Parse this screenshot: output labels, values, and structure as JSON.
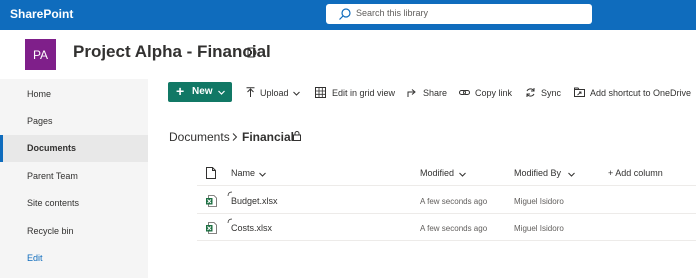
{
  "topbar": {
    "app_name": "SharePoint",
    "search_placeholder": "Search this library"
  },
  "site": {
    "logo_initials": "PA",
    "title": "Project Alpha - Financial"
  },
  "leftnav": {
    "items": [
      {
        "label": "Home"
      },
      {
        "label": "Pages"
      },
      {
        "label": "Documents",
        "active": true
      },
      {
        "label": "Parent Team"
      },
      {
        "label": "Site contents"
      },
      {
        "label": "Recycle bin"
      },
      {
        "label": "Edit"
      }
    ]
  },
  "commandbar": {
    "new_label": "New",
    "upload_label": "Upload",
    "grid_label": "Edit in grid view",
    "share_label": "Share",
    "copy_link_label": "Copy link",
    "sync_label": "Sync",
    "shortcut_label": "Add shortcut to OneDrive"
  },
  "breadcrumb": {
    "root": "Documents",
    "current": "Financial"
  },
  "table": {
    "columns": {
      "name": "Name",
      "modified": "Modified",
      "modified_by": "Modified By",
      "add_column": "+ Add column"
    },
    "rows": [
      {
        "name": "Budget.xlsx",
        "modified": "A few seconds ago",
        "modified_by": "Miguel Isidoro"
      },
      {
        "name": "Costs.xlsx",
        "modified": "A few seconds ago",
        "modified_by": "Miguel Isidoro"
      }
    ]
  },
  "colors": {
    "suite_bar": "#0f6cbd",
    "site_logo": "#7f1f8a",
    "new_button": "#117865",
    "excel_green": "#1d6f42"
  }
}
